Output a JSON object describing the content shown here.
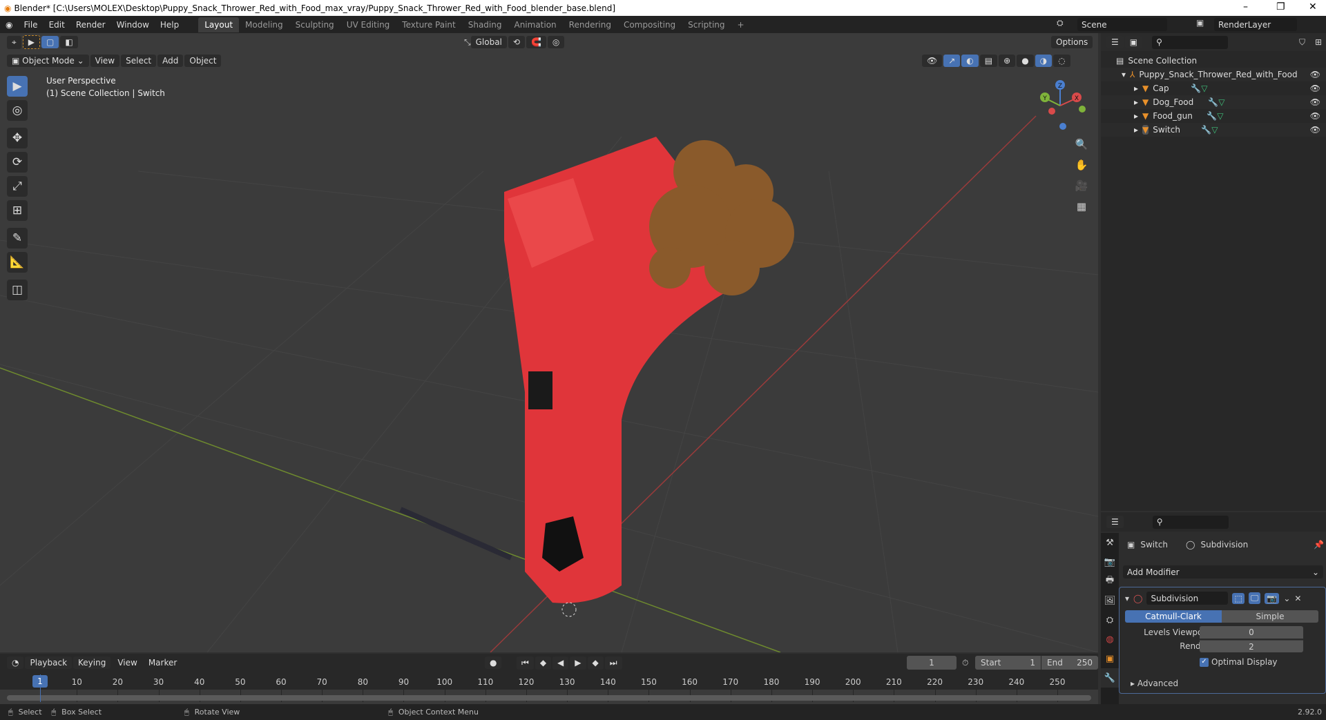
{
  "window": {
    "title": "Blender* [C:\\Users\\MOLEX\\Desktop\\Puppy_Snack_Thrower_Red_with_Food_max_vray/Puppy_Snack_Thrower_Red_with_Food_blender_base.blend]"
  },
  "menus": [
    "File",
    "Edit",
    "Render",
    "Window",
    "Help"
  ],
  "workspaces": [
    "Layout",
    "Modeling",
    "Sculpting",
    "UV Editing",
    "Texture Paint",
    "Shading",
    "Animation",
    "Rendering",
    "Compositing",
    "Scripting",
    "+"
  ],
  "scene": "Scene",
  "render_layer": "RenderLayer",
  "viewport": {
    "orientation": "Global",
    "options": "Options",
    "mode": "Object Mode",
    "menus": [
      "View",
      "Select",
      "Add",
      "Object"
    ],
    "overlay_title": "User Perspective",
    "overlay_sub": "(1) Scene Collection | Switch",
    "gizmo": {
      "x": "X",
      "y": "Y",
      "z": "Z"
    }
  },
  "outliner": {
    "root": "Scene Collection",
    "collection": "Puppy_Snack_Thrower_Red_with_Food",
    "objects": [
      "Cap",
      "Dog_Food",
      "Food_gun",
      "Switch"
    ]
  },
  "properties": {
    "object": "Switch",
    "modifier_crumb": "Subdivision",
    "add_modifier": "Add Modifier",
    "modifier_name": "Subdivision",
    "types": [
      "Catmull-Clark",
      "Simple"
    ],
    "active_type": "Catmull-Clark",
    "levels_label": "Levels Viewport",
    "levels": "0",
    "render_label": "Render",
    "render": "2",
    "optimal": "Optimal Display",
    "optimal_checked": true,
    "advanced": "Advanced"
  },
  "timeline": {
    "menus": [
      "Playback",
      "Keying",
      "View",
      "Marker"
    ],
    "current": "1",
    "start_label": "Start",
    "start": "1",
    "end_label": "End",
    "end": "250",
    "ticks": [
      10,
      20,
      30,
      40,
      50,
      60,
      70,
      80,
      90,
      100,
      110,
      120,
      130,
      140,
      150,
      160,
      170,
      180,
      190,
      200,
      210,
      220,
      230,
      240,
      250
    ]
  },
  "status": {
    "select": "Select",
    "box": "Box Select",
    "rotate": "Rotate View",
    "context": "Object Context Menu",
    "version": "2.92.0"
  },
  "colors": {
    "accent": "#4772b3",
    "object": "#e8403f",
    "food": "#8a5a2b"
  }
}
